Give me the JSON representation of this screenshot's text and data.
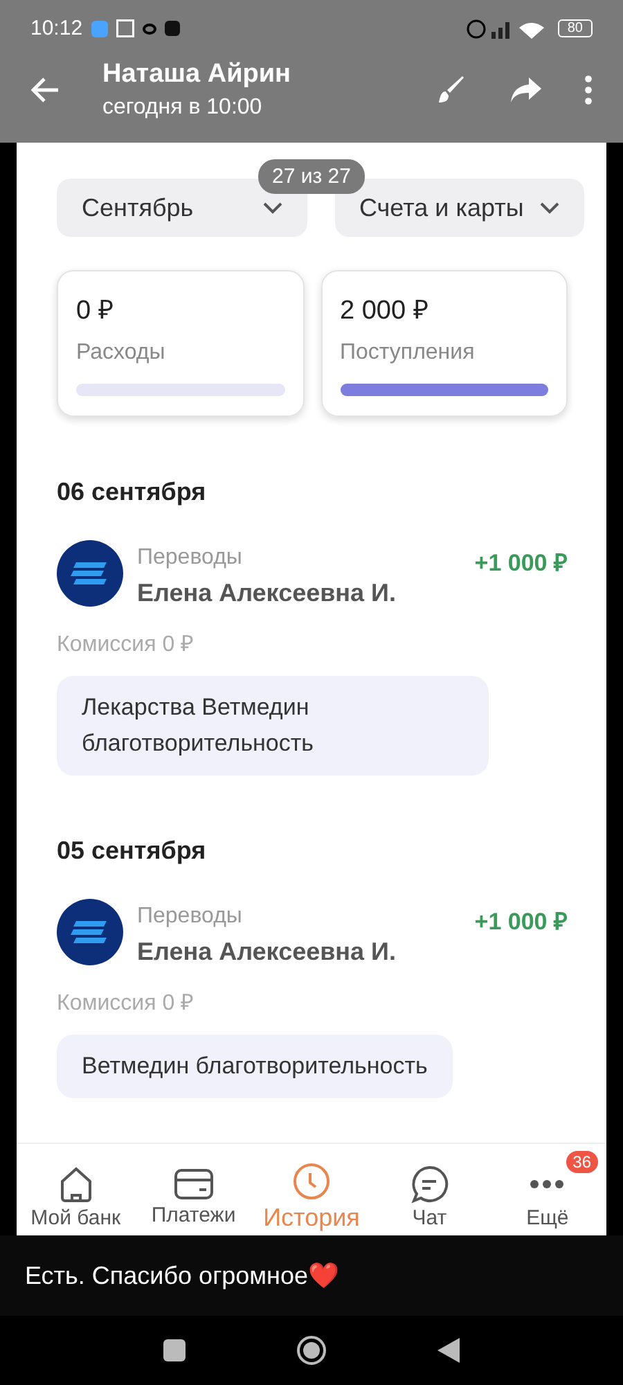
{
  "status_bar": {
    "time": "10:12",
    "battery": "80"
  },
  "viewer": {
    "sender": "Наташа Айрин",
    "time": "сегодня в 10:00",
    "counter": "27 из 27",
    "caption": "Есть. Спасибо огромное❤️"
  },
  "filters": [
    {
      "label": "Сентябрь"
    },
    {
      "label": "Счета и карты"
    }
  ],
  "summary": [
    {
      "amount": "0 ₽",
      "label": "Расходы",
      "level": 0
    },
    {
      "amount": "2 000 ₽",
      "label": "Поступления",
      "level": 1
    }
  ],
  "days": [
    {
      "date": "06 сентября",
      "transactions": [
        {
          "category": "Переводы",
          "name": "Елена Алексеевна И.",
          "amount": "+1 000 ₽",
          "fee": "Комиссия 0 ₽",
          "message": "Лекарства Ветмедин благотворительность"
        }
      ]
    },
    {
      "date": "05 сентября",
      "transactions": [
        {
          "category": "Переводы",
          "name": "Елена Алексеевна И.",
          "amount": "+1 000 ₽",
          "fee": "Комиссия 0 ₽",
          "message": "Ветмедин благотворительность"
        }
      ]
    }
  ],
  "nav": [
    {
      "label": "Мой банк",
      "selected": false
    },
    {
      "label": "Платежи",
      "selected": false
    },
    {
      "label": "История",
      "selected": true
    },
    {
      "label": "Чат",
      "selected": false
    },
    {
      "label": "Ещё",
      "selected": false,
      "badge": "36"
    }
  ]
}
